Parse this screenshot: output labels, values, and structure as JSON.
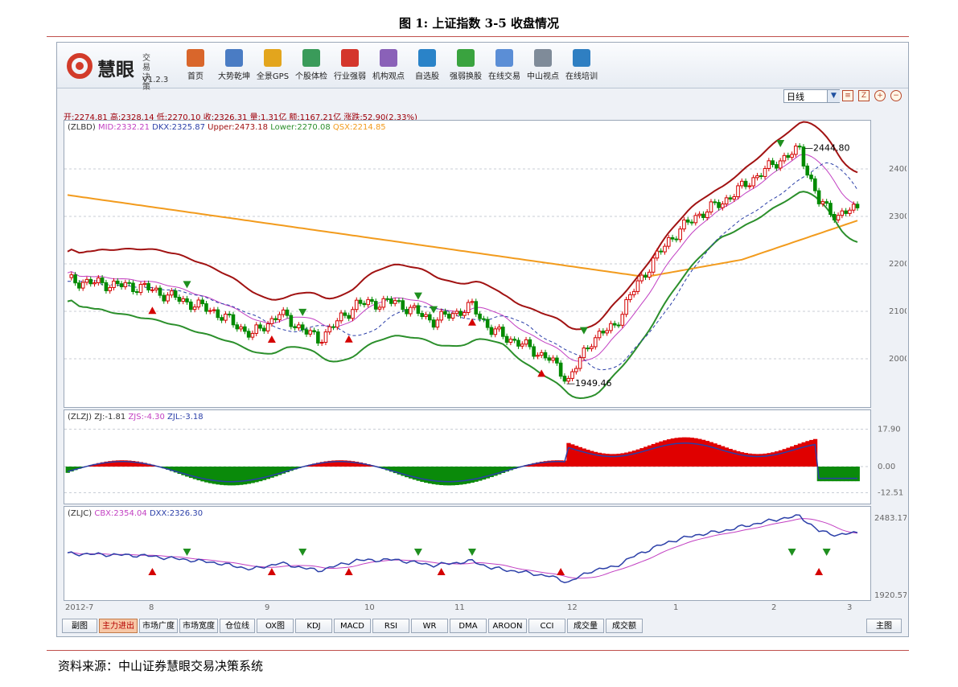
{
  "figure_title": "图 1:  上证指数 3-5 收盘情况",
  "source_note": "资料来源：中山证券慧眼交易决策系统",
  "app": {
    "logo_text": "慧眼",
    "logo_sub": "交易决策",
    "version": "V1.2.3",
    "toolbar": [
      {
        "label": "首页",
        "icon": "home-icon",
        "color": "#d9662b"
      },
      {
        "label": "大势乾坤",
        "icon": "magnifier-doc-icon",
        "color": "#4a7cc4"
      },
      {
        "label": "全景GPS",
        "icon": "grid-icon",
        "color": "#e3a51d"
      },
      {
        "label": "个股体检",
        "icon": "checklist-icon",
        "color": "#3a9b5a"
      },
      {
        "label": "行业强弱",
        "icon": "bar-chart-icon",
        "color": "#d4362c"
      },
      {
        "label": "机构观点",
        "icon": "people-icon",
        "color": "#8a61b8"
      },
      {
        "label": "自选股",
        "icon": "cube-icon",
        "color": "#2a83c8"
      },
      {
        "label": "强弱换股",
        "icon": "cycle-icon",
        "color": "#3aa33f"
      },
      {
        "label": "在线交易",
        "icon": "trade-icon",
        "color": "#5b8ed6"
      },
      {
        "label": "中山视点",
        "icon": "document-icon",
        "color": "#7f8b99"
      },
      {
        "label": "在线培训",
        "icon": "monitor-icon",
        "color": "#2f7fc2"
      }
    ],
    "period": "日线",
    "stats_line": "开:2274.81 高:2328.14 低:2270.10 收:2326.31 量:1.31亿 额:1167.21亿 涨跌:52.90(2.33%)",
    "main_legend": [
      {
        "text": "(ZLBD)",
        "color": "#333333"
      },
      {
        "text": "MID:2332.21",
        "color": "#c23fc2"
      },
      {
        "text": "DKX:2325.87",
        "color": "#2b3fa8"
      },
      {
        "text": "Upper:2473.18",
        "color": "#a11212"
      },
      {
        "text": "Lower:2270.08",
        "color": "#2b8f2b"
      },
      {
        "text": "QSX:2214.85",
        "color": "#f29b1d"
      }
    ],
    "zlzj_legend": [
      {
        "text": "(ZLZJ)",
        "color": "#333333"
      },
      {
        "text": "ZJ:-1.81",
        "color": "#333333"
      },
      {
        "text": "ZJS:-4.30",
        "color": "#c23fc2"
      },
      {
        "text": "ZJL:-3.18",
        "color": "#2b3fa8"
      }
    ],
    "zljc_legend": [
      {
        "text": "(ZLJC)",
        "color": "#333333"
      },
      {
        "text": "CBX:2354.04",
        "color": "#c23fc2"
      },
      {
        "text": "DXX:2326.30",
        "color": "#2b3fa8"
      }
    ],
    "main_y_ticks": [
      "2400",
      "2300",
      "2200",
      "2100",
      "2000"
    ],
    "zlzj_y_ticks": [
      "17.90",
      "0.00",
      "-12.51"
    ],
    "zljc_y_ticks": [
      "2483.17",
      "1920.57"
    ],
    "annotation_high": "2444.80",
    "annotation_low": "1949.46",
    "date_labels": [
      "2012-7",
      "8",
      "9",
      "10",
      "11",
      "12",
      "1",
      "2",
      "3"
    ],
    "bottom_tabs": [
      "副图",
      "主力进出",
      "市场广度",
      "市场宽度",
      "仓位线",
      "OX图",
      "KDJ",
      "MACD",
      "RSI",
      "WR",
      "DMA",
      "AROON",
      "CCI",
      "成交量",
      "成交额"
    ],
    "main_tab": "主图"
  },
  "colors": {
    "up": "#d40000",
    "down": "#008a00",
    "rule": "#c0504d"
  }
}
